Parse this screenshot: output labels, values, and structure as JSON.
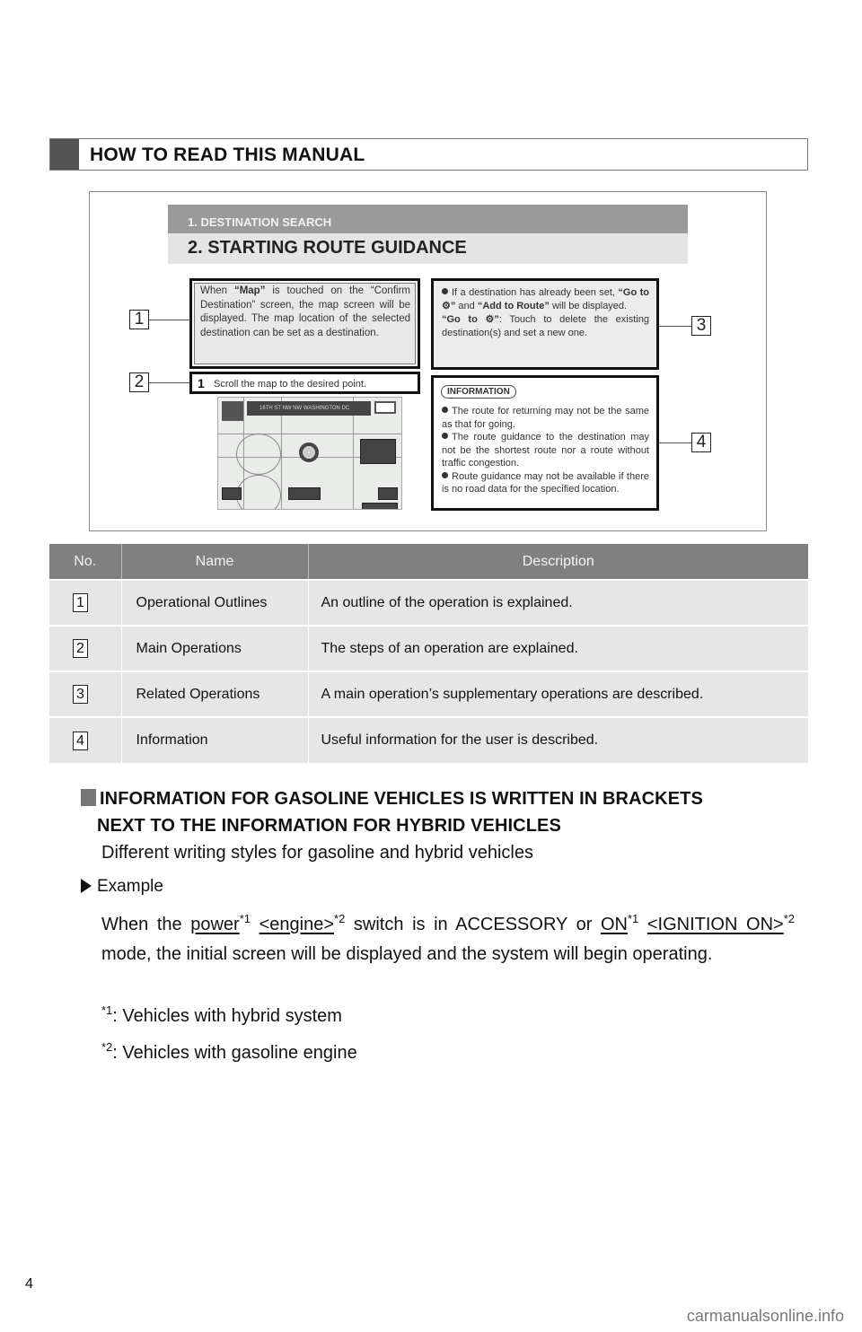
{
  "section_title": "HOW TO READ THIS MANUAL",
  "illustration": {
    "band_chapter": "1. DESTINATION SEARCH",
    "band_section": "2. STARTING ROUTE GUIDANCE",
    "outline_text_pre": "When ",
    "outline_bold": "“Map”",
    "outline_text_post": " is touched on the “Confirm Destination” screen, the map screen will be displayed. The map location of the selected destination can be set as a destination.",
    "step_number": "1",
    "step_text": "Scroll the map to the desired point.",
    "related_line1_pre": "If a destination has already been set, ",
    "related_bold1": "“Go to ⚙”",
    "related_mid": " and ",
    "related_bold2": "“Add to Route”",
    "related_line1_post": " will be displayed.",
    "related_line2_bold": "“Go to ⚙”",
    "related_line2_text": ": Touch to delete the existing destination(s) and set a new one.",
    "info_label": "INFORMATION",
    "info_items": [
      "The route for returning may not be the same as that for going.",
      "The route guidance to the destination may not be the shortest route nor a route without traffic congestion.",
      "Route guidance may not be available if there is no road data for the specified location."
    ],
    "map_bar_text": "16TH ST NW NW WASHINGTON DC",
    "callouts": [
      "1",
      "2",
      "3",
      "4"
    ]
  },
  "table": {
    "headers": [
      "No.",
      "Name",
      "Description"
    ],
    "rows": [
      {
        "no": "1",
        "name": "Operational Outlines",
        "desc": "An outline of the operation is explained."
      },
      {
        "no": "2",
        "name": "Main Operations",
        "desc": "The steps of an operation are explained."
      },
      {
        "no": "3",
        "name": "Related Operations",
        "desc": "A main operation’s supplementary operations are described."
      },
      {
        "no": "4",
        "name": "Information",
        "desc": "Useful information for the user is described."
      }
    ]
  },
  "subsection": {
    "heading_line1": "INFORMATION FOR GASOLINE VEHICLES IS WRITTEN IN BRACKETS",
    "heading_line2": "NEXT TO THE INFORMATION FOR HYBRID VEHICLES",
    "intro": "Different writing styles for gasoline and hybrid vehicles",
    "example_label": "Example",
    "para": {
      "t1": "When the ",
      "u1": "power",
      "s1": "*1",
      "u2": "<engine>",
      "s2": "*2",
      "t2": " switch is in ACCESSORY or ",
      "u3": "ON",
      "s3": "*1",
      "u4": "<IGNITION ON>",
      "s4": "*2",
      "t3": " mode, the initial screen will be displayed and the system will begin operating."
    },
    "note1_sup": "*1",
    "note1_text": ": Vehicles with hybrid system",
    "note2_sup": "*2",
    "note2_text": ": Vehicles with gasoline engine"
  },
  "footer": {
    "page_number": "4",
    "watermark": "carmanualsonline.info"
  }
}
